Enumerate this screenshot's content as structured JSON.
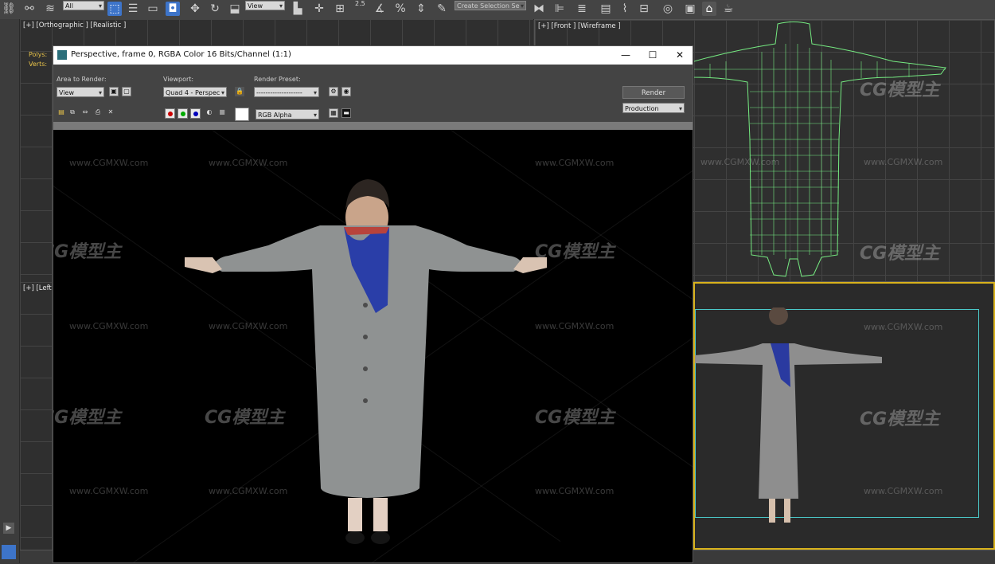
{
  "toolbar": {
    "selection_filter": "All",
    "ref_coord": "View",
    "snap_angle": "2.5",
    "named_selection_placeholder": "Create Selection Se"
  },
  "viewports": {
    "top_left": {
      "label": "[+] [Orthographic ] [Realistic ]",
      "stats1": "Polys:",
      "stats2": "Verts:"
    },
    "top_right": {
      "label": "[+] [Front ] [Wireframe ]"
    },
    "bottom_left": {
      "label": "[+] [Left"
    }
  },
  "render_window": {
    "title": "Perspective, frame 0, RGBA Color 16 Bits/Channel (1:1)",
    "controls": {
      "minimize": "—",
      "maximize": "☐",
      "close": "✕"
    },
    "area_to_render_label": "Area to Render:",
    "area_to_render_value": "View",
    "viewport_label": "Viewport:",
    "viewport_value": "Quad 4 - Perspec",
    "render_preset_label": "Render Preset:",
    "render_preset_value": "--------------------",
    "render_button": "Render",
    "production_value": "Production",
    "channel_value": "RGB Alpha"
  },
  "watermarks": {
    "url": "www.CGMXW.com",
    "logo": "CG模型主"
  },
  "colors": {
    "accent_blue": "#3d74c9",
    "wireframe_green": "#7dff8a",
    "viewport_yellow": "#d8b21c",
    "viewport_cyan": "#4bc9c9"
  },
  "icons": [
    "link-icon",
    "unlink-icon",
    "bind-icon",
    "select-icon",
    "select-by-name-icon",
    "rect-region-icon",
    "window-crossing-icon",
    "move-icon",
    "rotate-icon",
    "scale-icon",
    "snap-icon",
    "angle-snap-icon",
    "percent-snap-icon",
    "spinner-snap-icon",
    "mirror-icon",
    "align-icon",
    "layer-icon",
    "curve-editor-icon",
    "material-editor-icon",
    "render-setup-icon",
    "render-frame-icon",
    "render-teapot-icon"
  ]
}
